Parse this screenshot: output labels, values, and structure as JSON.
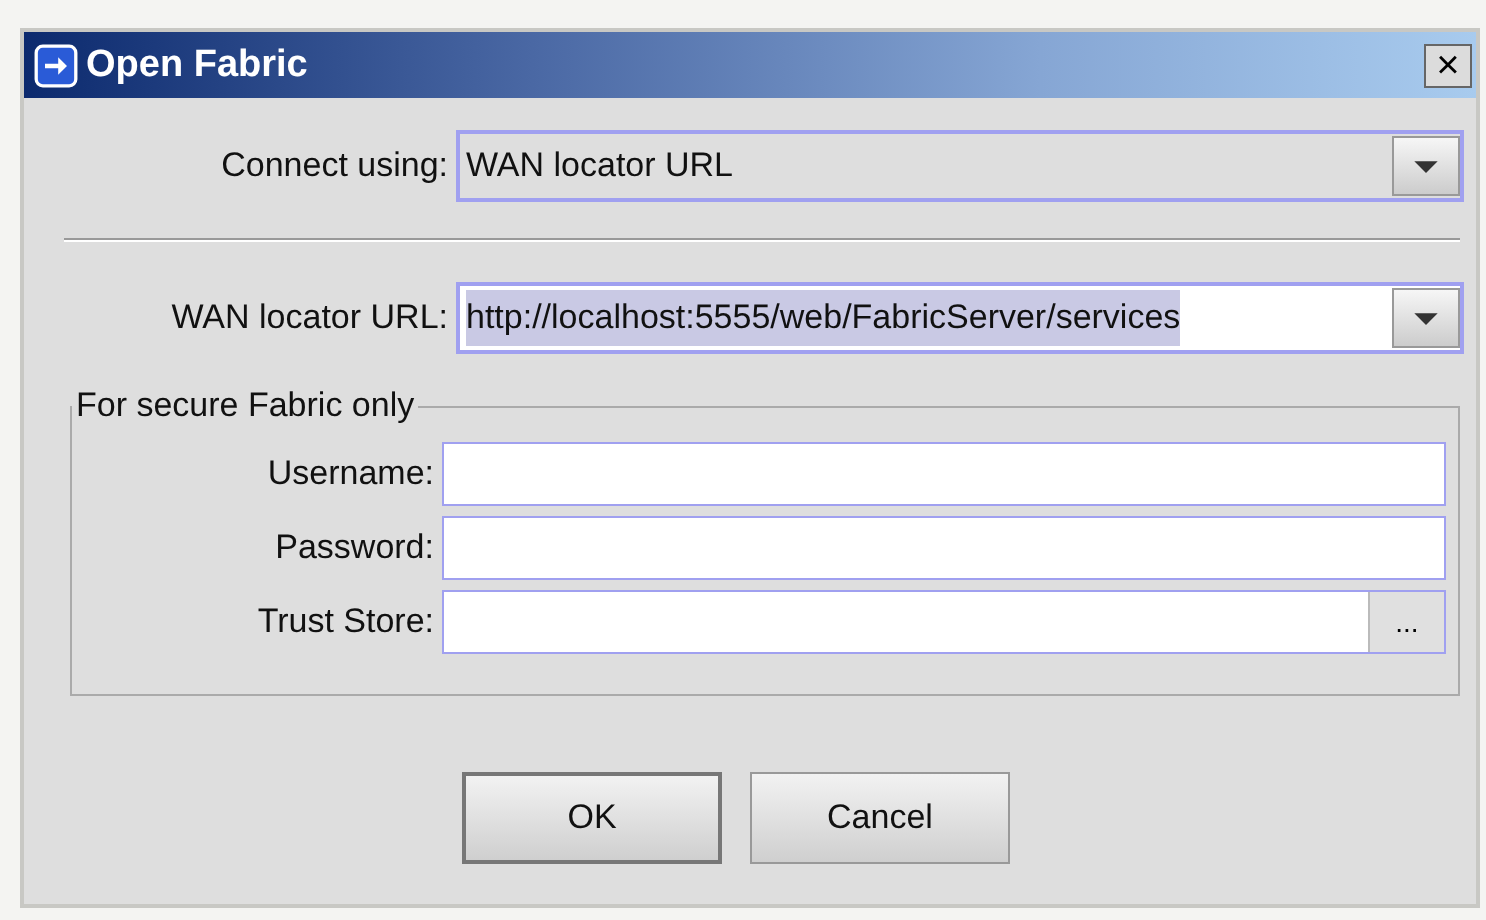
{
  "window": {
    "title": "Open Fabric",
    "close": "×"
  },
  "connect": {
    "label": "Connect using:",
    "value": "WAN locator URL"
  },
  "url": {
    "label": "WAN locator URL:",
    "value": "http://localhost:5555/web/FabricServer/services",
    "selected": true
  },
  "group": {
    "title": "For secure Fabric only",
    "fields": [
      {
        "label": "Username:",
        "kind": "text"
      },
      {
        "label": "Password:",
        "kind": "text"
      },
      {
        "label": "Trust Store:",
        "kind": "browse",
        "button": "..."
      }
    ]
  },
  "buttons": [
    {
      "label": "OK",
      "default": true
    },
    {
      "label": "Cancel",
      "default": false
    }
  ]
}
